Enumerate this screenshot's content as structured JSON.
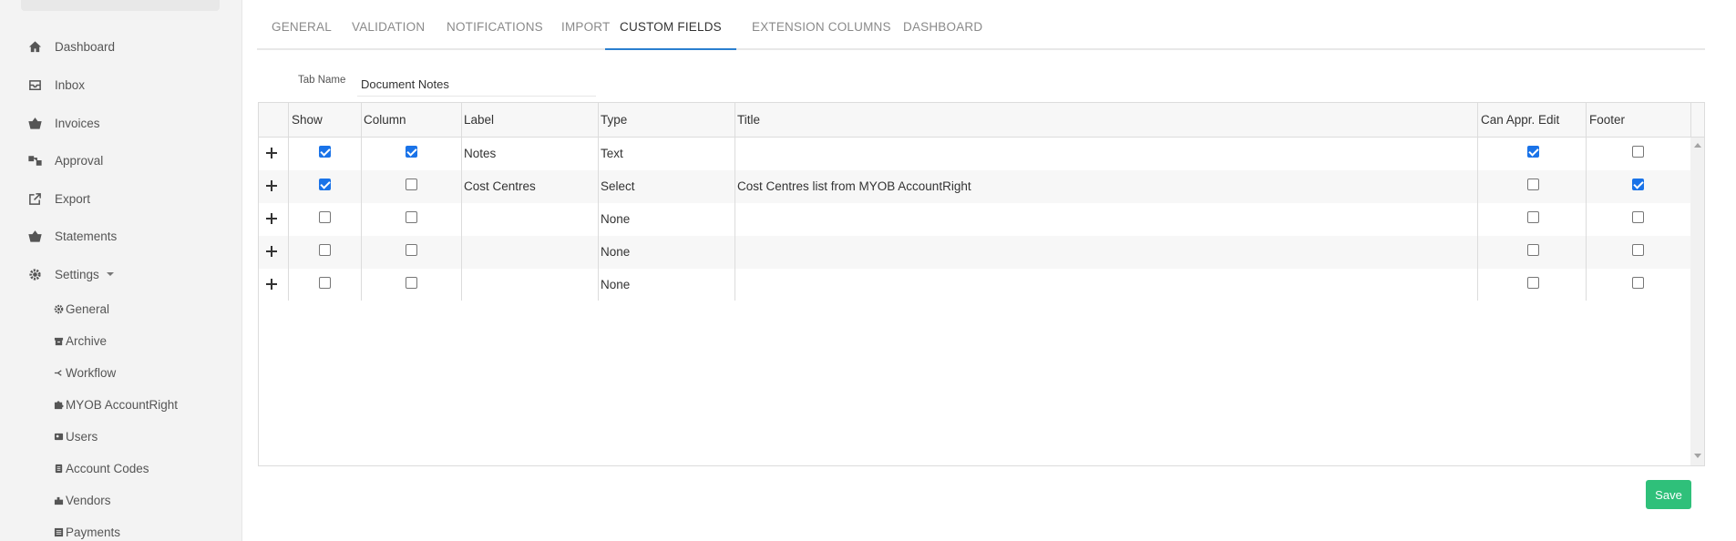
{
  "sidebar": {
    "items": [
      {
        "label": "Dashboard",
        "icon": "home-icon"
      },
      {
        "label": "Inbox",
        "icon": "inbox-icon"
      },
      {
        "label": "Invoices",
        "icon": "basket-icon"
      },
      {
        "label": "Approval",
        "icon": "approval-icon"
      },
      {
        "label": "Export",
        "icon": "external-link-icon"
      },
      {
        "label": "Statements",
        "icon": "basket-icon"
      },
      {
        "label": "Settings",
        "icon": "gear-icon"
      }
    ],
    "settings_items": [
      {
        "label": "General",
        "icon": "gear-icon"
      },
      {
        "label": "Archive",
        "icon": "archive-icon"
      },
      {
        "label": "Workflow",
        "icon": "workflow-icon"
      },
      {
        "label": "MYOB AccountRight",
        "icon": "puzzle-icon"
      },
      {
        "label": "Users",
        "icon": "users-icon"
      },
      {
        "label": "Account Codes",
        "icon": "clipboard-icon"
      },
      {
        "label": "Vendors",
        "icon": "building-icon"
      },
      {
        "label": "Payments",
        "icon": "list-icon"
      }
    ]
  },
  "tabs": [
    {
      "label": "GENERAL",
      "active": false
    },
    {
      "label": "VALIDATION",
      "active": false
    },
    {
      "label": "NOTIFICATIONS",
      "active": false
    },
    {
      "label": "IMPORT",
      "active": false
    },
    {
      "label": "CUSTOM FIELDS",
      "active": true
    },
    {
      "label": "EXTENSION COLUMNS",
      "active": false
    },
    {
      "label": "DASHBOARD",
      "active": false
    }
  ],
  "tab_name": {
    "label": "Tab Name",
    "value": "Document Notes"
  },
  "grid": {
    "headers": [
      "Show",
      "Column",
      "Label",
      "Type",
      "Title",
      "Can Appr. Edit",
      "Footer"
    ],
    "rows": [
      {
        "show": true,
        "column": true,
        "label": "Notes",
        "type": "Text",
        "title": "",
        "can_appr_edit": true,
        "footer": false
      },
      {
        "show": true,
        "column": false,
        "label": "Cost Centres",
        "type": "Select",
        "title": "Cost Centres list from MYOB AccountRight",
        "can_appr_edit": false,
        "footer": true
      },
      {
        "show": false,
        "column": false,
        "label": "",
        "type": "None",
        "title": "",
        "can_appr_edit": false,
        "footer": false
      },
      {
        "show": false,
        "column": false,
        "label": "",
        "type": "None",
        "title": "",
        "can_appr_edit": false,
        "footer": false
      },
      {
        "show": false,
        "column": false,
        "label": "",
        "type": "None",
        "title": "",
        "can_appr_edit": false,
        "footer": false
      }
    ]
  },
  "save_label": "Save",
  "colors": {
    "accent": "#2a7fcf",
    "save": "#2fc07a",
    "checkbox": "#1a73e8"
  }
}
